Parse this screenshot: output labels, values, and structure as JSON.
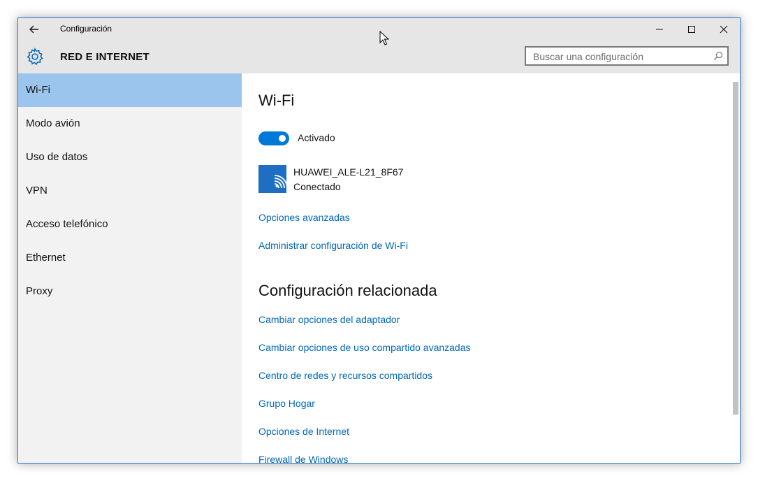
{
  "window": {
    "title": "Configuración",
    "accent": "#0078d7"
  },
  "header": {
    "section": "RED E INTERNET",
    "search_placeholder": "Buscar una configuración"
  },
  "sidebar": {
    "items": [
      {
        "label": "Wi-Fi",
        "selected": true
      },
      {
        "label": "Modo avión",
        "selected": false
      },
      {
        "label": "Uso de datos",
        "selected": false
      },
      {
        "label": "VPN",
        "selected": false
      },
      {
        "label": "Acceso telefónico",
        "selected": false
      },
      {
        "label": "Ethernet",
        "selected": false
      },
      {
        "label": "Proxy",
        "selected": false
      }
    ]
  },
  "content": {
    "title": "Wi-Fi",
    "toggle": {
      "label": "Activado",
      "state": "on"
    },
    "network": {
      "name": "HUAWEI_ALE-L21_8F67",
      "status": "Conectado",
      "icon": "wifi-signal-icon"
    },
    "links": [
      "Opciones avanzadas",
      "Administrar configuración de Wi-Fi"
    ],
    "related_title": "Configuración relacionada",
    "related_links": [
      "Cambiar opciones del adaptador",
      "Cambiar opciones de uso compartido avanzadas",
      "Centro de redes y recursos compartidos",
      "Grupo Hogar",
      "Opciones de Internet",
      "Firewall de Windows"
    ]
  }
}
